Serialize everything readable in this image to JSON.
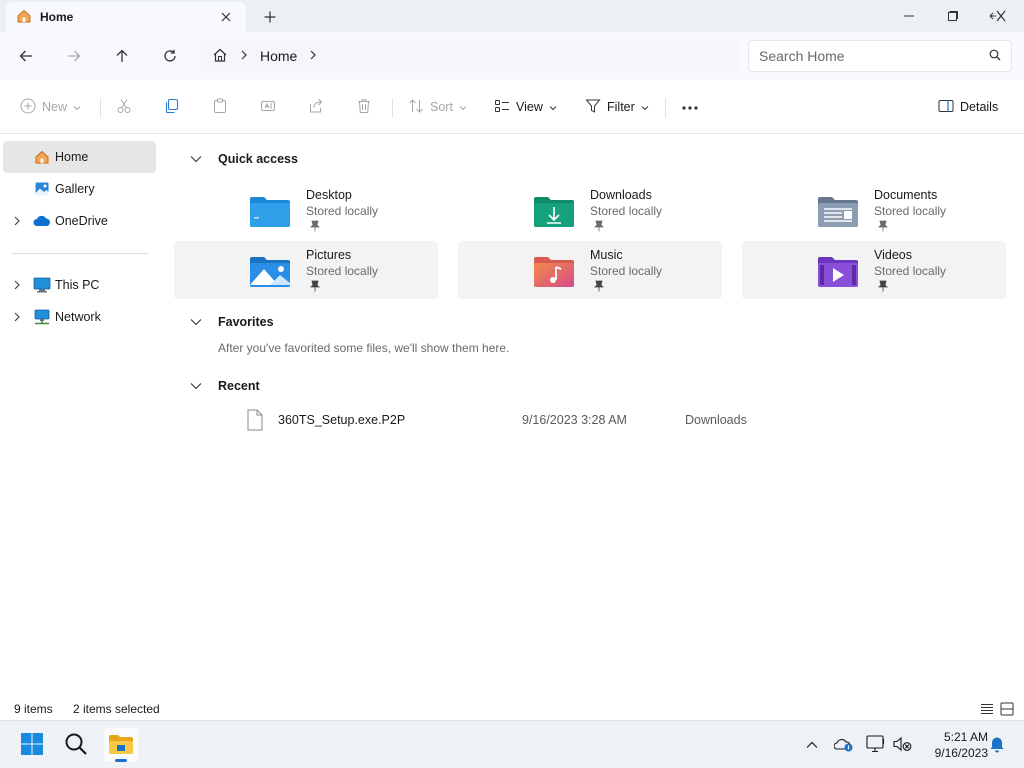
{
  "window": {
    "tab_title": "Home",
    "tab_icon": "home-icon",
    "controls": [
      "minimize-icon",
      "maximize-icon",
      "close-icon"
    ]
  },
  "nav": {
    "breadcrumb": [
      "Home"
    ],
    "search_placeholder": "Search Home"
  },
  "toolbar": {
    "new_label": "New",
    "sort_label": "Sort",
    "view_label": "View",
    "filter_label": "Filter",
    "more_label": "...",
    "details_label": "Details"
  },
  "sidebar": {
    "items": [
      {
        "label": "Home",
        "icon": "home-icon",
        "active": true,
        "expandable": false
      },
      {
        "label": "Gallery",
        "icon": "gallery-icon",
        "active": false,
        "expandable": false
      },
      {
        "label": "OneDrive",
        "icon": "cloud-icon",
        "active": false,
        "expandable": true
      },
      {
        "label": "This PC",
        "icon": "computer-icon",
        "active": false,
        "expandable": true
      },
      {
        "label": "Network",
        "icon": "network-icon",
        "active": false,
        "expandable": true
      }
    ]
  },
  "quick_access": {
    "header": "Quick access",
    "items": [
      {
        "name": "Desktop",
        "sub": "Stored locally",
        "color": "#1e88d8"
      },
      {
        "name": "Downloads",
        "sub": "Stored locally",
        "color": "#16a07c"
      },
      {
        "name": "Documents",
        "sub": "Stored locally",
        "color": "#7f8fa8"
      },
      {
        "name": "Pictures",
        "sub": "Stored locally",
        "color": "#2a8ee6"
      },
      {
        "name": "Music",
        "sub": "Stored locally",
        "color": "#e8795a"
      },
      {
        "name": "Videos",
        "sub": "Stored locally",
        "color": "#8a4fd8"
      }
    ]
  },
  "favorites": {
    "header": "Favorites",
    "empty_message": "After you've favorited some files, we'll show them here."
  },
  "recent": {
    "header": "Recent",
    "items": [
      {
        "name": "360TS_Setup.exe.P2P",
        "date": "9/16/2023 3:28 AM",
        "location": "Downloads"
      }
    ]
  },
  "status": {
    "items_count": "9 items",
    "selected_count": "2 items selected"
  },
  "taskbar": {
    "time": "5:21 AM",
    "date": "9/16/2023"
  }
}
